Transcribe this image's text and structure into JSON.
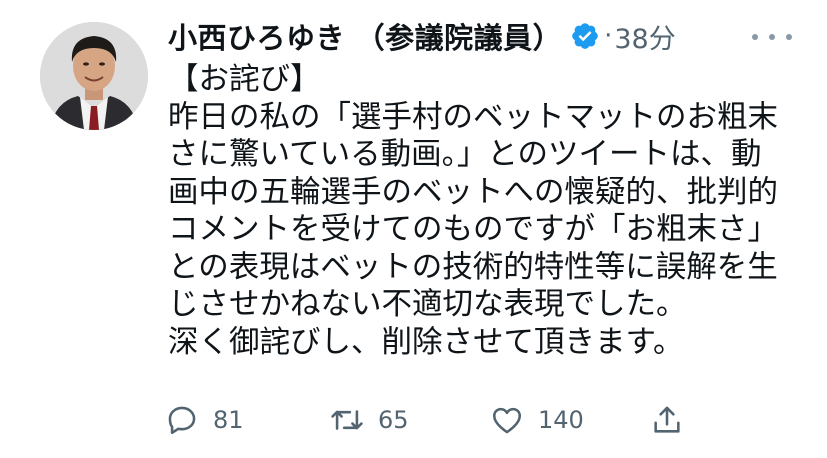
{
  "tweet": {
    "author_name": "小西ひろゆき （参議院議員）",
    "timestamp": "38分",
    "separator": "·",
    "verified": true,
    "lines": [
      "【お詫び】",
      "昨日の私の「選手村のベットマットのお粗末",
      "さに驚いている動画。」とのツイートは、動",
      "画中の五輪選手のベットへの懐疑的、批判的",
      "コメントを受けてのものですが「お粗末さ」",
      "との表現はベットの技術的特性等に誤解を生",
      "じさせかねない不適切な表現でした。",
      "深く御詫びし、削除させて頂きます。"
    ]
  },
  "actions": {
    "reply_count": "81",
    "retweet_count": "65",
    "like_count": "140",
    "reply_icon": "reply-icon",
    "retweet_icon": "retweet-icon",
    "like_icon": "heart-icon",
    "share_icon": "share-icon"
  },
  "colors": {
    "verified_badge": "#1d9bf0",
    "secondary_text": "#536471",
    "primary_text": "#0f1419"
  }
}
